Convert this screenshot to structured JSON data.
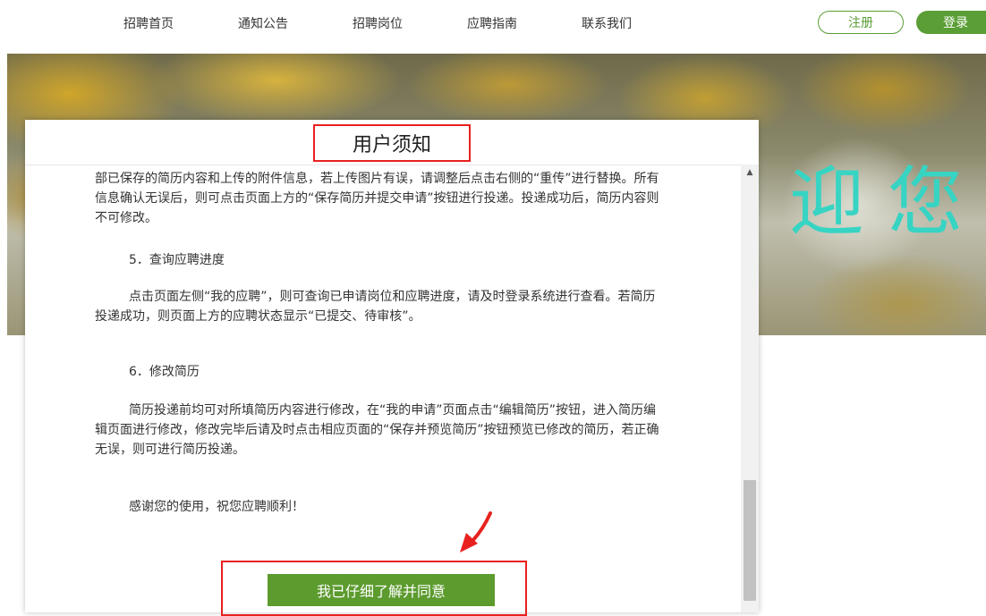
{
  "nav": {
    "items": [
      "招聘首页",
      "通知公告",
      "招聘岗位",
      "应聘指南",
      "联系我们"
    ],
    "register_label": "注册",
    "login_label": "登录"
  },
  "banner": {
    "text": "迎您"
  },
  "modal": {
    "title": "用户须知",
    "fragment": "部已保存的简历内容和上传的附件信息，若上传图片有误，请调整后点击右侧的“重传”进行替换。所有信息确认无误后，则可点击页面上方的“保存简历并提交申请”按钮进行投递。投递成功后，简历内容则不可修改。",
    "section5_heading": "5．查询应聘进度",
    "section5_body": "点击页面左侧“我的应聘”，则可查询已申请岗位和应聘进度，请及时登录系统进行查看。若简历投递成功，则页面上方的应聘状态显示“已提交、待审核”。",
    "section6_heading": "6．修改简历",
    "section6_body": "简历投递前均可对所填简历内容进行修改，在“我的申请”页面点击“编辑简历”按钮，进入简历编辑页面进行修改，修改完毕后请及时点击相应页面的“保存并预览简历”按钮预览已修改的简历，若正确无误，则可进行简历投递。",
    "thanks": "感谢您的使用，祝您应聘顺利！",
    "agree_label": "我已仔细了解并同意"
  },
  "colors": {
    "accent": "#5c9b2e",
    "highlight": "#e8211e",
    "banner_text": "#37d4c3"
  },
  "icons": {
    "scroll_up": "chevron-up-icon",
    "annotation": "red-arrow-icon"
  }
}
